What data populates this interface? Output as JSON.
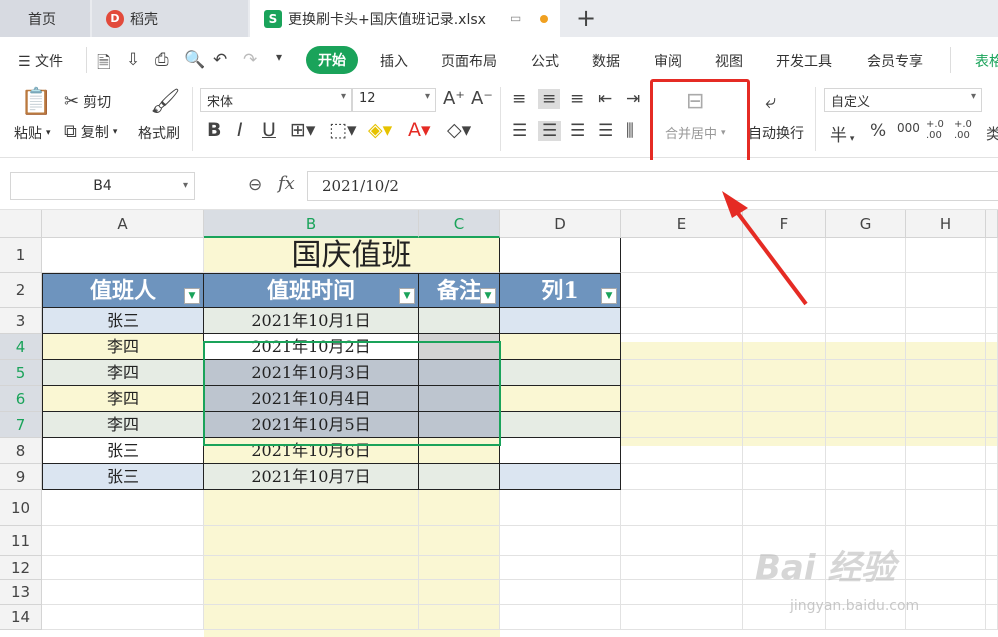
{
  "tabs": {
    "home": "首页",
    "daoke": "稻壳",
    "file": "更换刷卡头+国庆值班记录.xlsx",
    "new_tab": "+"
  },
  "menu": {
    "file": "文件",
    "items": [
      "开始",
      "插入",
      "页面布局",
      "公式",
      "数据",
      "审阅",
      "视图",
      "开发工具",
      "会员专享",
      "表格"
    ]
  },
  "ribbon": {
    "paste": "粘贴",
    "cut": "剪切",
    "copy": "复制",
    "format_painter": "格式刷",
    "font_name": "宋体",
    "font_size": "12",
    "merge_center": "合并居中",
    "wrap_text": "自动换行",
    "number_format": "自定义",
    "currency_symbol": "半",
    "percent": "%",
    "thousands": "000",
    "dec_increase": "+.0 .00",
    "dec_decrease": "+.0 .00",
    "type_partial": "类"
  },
  "formula_bar": {
    "name_box": "B4",
    "fx": "fx",
    "formula": "2021/10/2"
  },
  "grid": {
    "columns": [
      "A",
      "B",
      "C",
      "D",
      "E",
      "F",
      "G",
      "H"
    ],
    "rows": [
      "1",
      "2",
      "3",
      "4",
      "5",
      "6",
      "7",
      "8",
      "9",
      "10",
      "11",
      "12",
      "13",
      "14"
    ],
    "title": "国庆值班",
    "headers": [
      "值班人",
      "值班时间",
      "备注",
      "列1"
    ],
    "records": [
      {
        "person": "张三",
        "date": "2021年10月1日"
      },
      {
        "person": "李四",
        "date": "2021年10月2日"
      },
      {
        "person": "李四",
        "date": "2021年10月3日"
      },
      {
        "person": "李四",
        "date": "2021年10月4日"
      },
      {
        "person": "李四",
        "date": "2021年10月5日"
      },
      {
        "person": "张三",
        "date": "2021年10月6日"
      },
      {
        "person": "张三",
        "date": "2021年10月7日"
      }
    ]
  },
  "watermark": {
    "brand": "Bai 经验",
    "url": "jingyan.baidu.com"
  },
  "colors": {
    "accent_green": "#1aa35a",
    "header_blue": "#6e94be",
    "row_blue": "#dbe5f1",
    "row_yellow": "#faf7d3",
    "annotation_red": "#e52b24"
  }
}
